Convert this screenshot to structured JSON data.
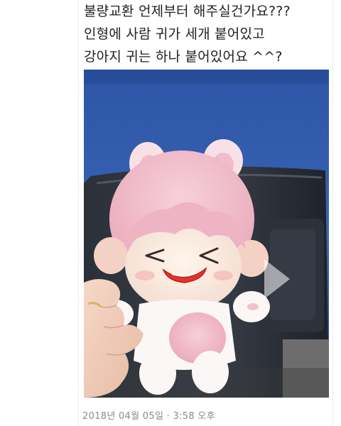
{
  "post": {
    "lines": [
      "불량교환 언제부터 해주실건가요???",
      "인형에 사람 귀가 세개 붙어있고",
      "강아지 귀는 하나 붙어있어요 ^^?"
    ],
    "timestamp": "2018년 04월 05일 · 3:58 오후"
  },
  "media": {
    "type": "video",
    "play_icon": "play-icon",
    "description_icon": "plush-doll-photo"
  },
  "colors": {
    "seat_blue": "#3b63b6",
    "doll_pink": "#f4c4cf",
    "text": "#222222",
    "timestamp": "#8a8a8a"
  }
}
